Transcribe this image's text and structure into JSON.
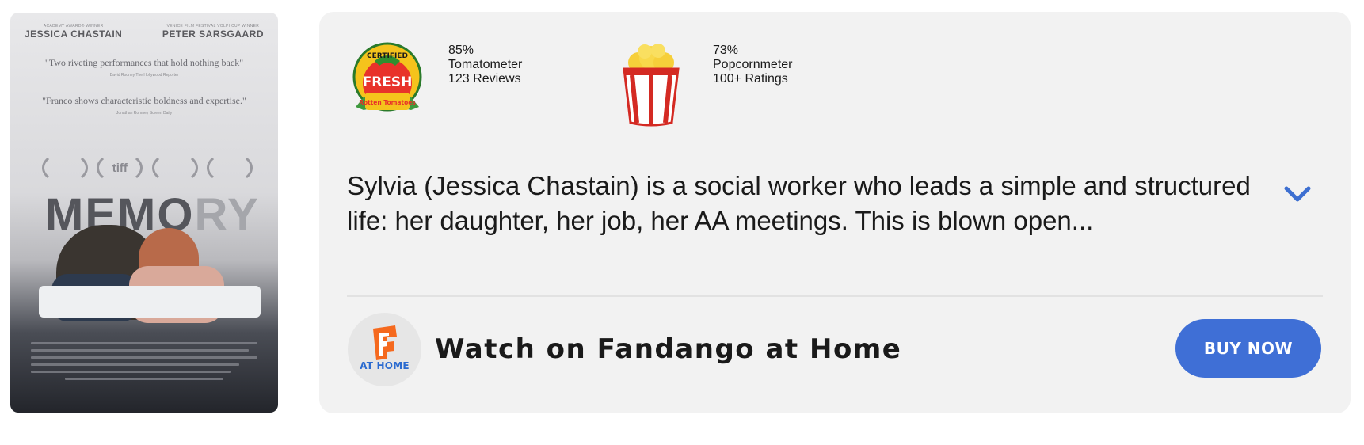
{
  "poster": {
    "actor_left": "JESSICA CHASTAIN",
    "actor_left_sub": "ACADEMY AWARD® WINNER",
    "actor_right": "PETER SARSGAARD",
    "actor_right_sub": "VENICE FILM FESTIVAL VOLPI CUP WINNER",
    "quote1": "\"Two riveting performances that hold nothing back\"",
    "quote1_source": "David Rooney The Hollywood Reporter",
    "quote2": "\"Franco shows characteristic boldness and expertise.\"",
    "quote2_source": "Jonathan Romney Screen Daily",
    "laurels": [
      "",
      "tiff",
      "",
      ""
    ],
    "title_main": "MEMO",
    "title_fade": "RY"
  },
  "scores": {
    "tomatometer": {
      "percent": "85%",
      "label": "Tomatometer",
      "count": "123 Reviews",
      "badge": {
        "top": "CERTIFIED",
        "middle": "FRESH",
        "bottom": "Rotten Tomatoes"
      }
    },
    "popcornmeter": {
      "percent": "73%",
      "label": "Popcornmeter",
      "count": "100+ Ratings"
    }
  },
  "synopsis": "Sylvia (Jessica Chastain) is a social worker who leads a simple and structured life: her daughter, her job, her AA meetings. This is blown open...",
  "icons": {
    "certified_fresh": "certified-fresh-icon",
    "popcorn": "popcorn-icon",
    "expand": "chevron-down-icon",
    "fandango": "fandango-at-home-icon"
  },
  "watch": {
    "logo_text": "AT HOME",
    "label": "Watch on Fandango at Home",
    "button": "BUY NOW"
  },
  "colors": {
    "accent": "#3f6fd6",
    "link": "#3d6fd1",
    "card_bg": "#f2f2f2",
    "fandango_orange": "#f5691e"
  }
}
